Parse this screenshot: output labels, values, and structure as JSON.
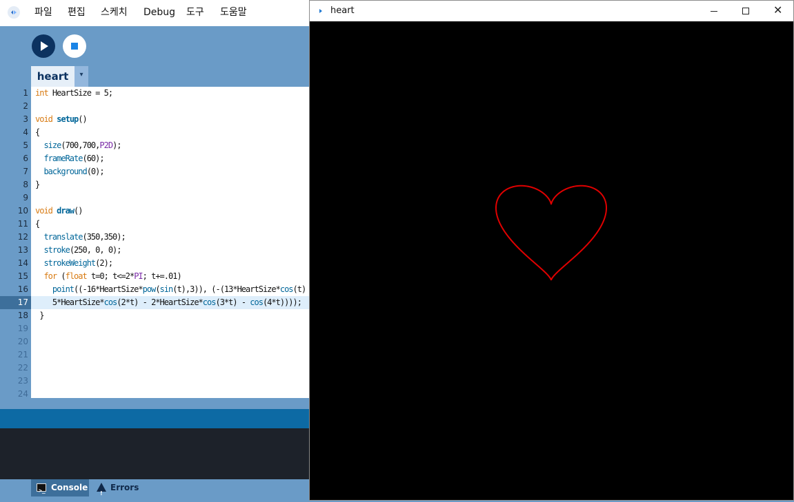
{
  "menu": [
    "파일",
    "편집",
    "스케치",
    "Debug",
    "도구",
    "도움말"
  ],
  "editor": {
    "tab_label": "heart",
    "tab_menu_glyph": "▾",
    "current_line": 17,
    "line_numbers": [
      "1",
      "2",
      "3",
      "4",
      "5",
      "6",
      "7",
      "8",
      "9",
      "10",
      "11",
      "12",
      "13",
      "14",
      "15",
      "16",
      "17",
      "18",
      "19",
      "20",
      "21",
      "22",
      "23",
      "24"
    ],
    "code": [
      [
        [
          "kw",
          "int"
        ],
        [
          "tx",
          " HeartSize = 5;"
        ]
      ],
      [],
      [
        [
          "kw",
          "void"
        ],
        [
          "tx",
          " "
        ],
        [
          "fn",
          "setup"
        ],
        [
          "tx",
          "()"
        ]
      ],
      [
        [
          "tx",
          "{"
        ]
      ],
      [
        [
          "tx",
          "  "
        ],
        [
          "fn2",
          "size"
        ],
        [
          "tx",
          "(700,700,"
        ],
        [
          "const",
          "P2D"
        ],
        [
          "tx",
          ");"
        ]
      ],
      [
        [
          "tx",
          "  "
        ],
        [
          "fn2",
          "frameRate"
        ],
        [
          "tx",
          "(60);"
        ]
      ],
      [
        [
          "tx",
          "  "
        ],
        [
          "fn2",
          "background"
        ],
        [
          "tx",
          "(0);"
        ]
      ],
      [
        [
          "tx",
          "}"
        ]
      ],
      [],
      [
        [
          "kw",
          "void"
        ],
        [
          "tx",
          " "
        ],
        [
          "fn",
          "draw"
        ],
        [
          "tx",
          "()"
        ]
      ],
      [
        [
          "tx",
          "{"
        ]
      ],
      [
        [
          "tx",
          "  "
        ],
        [
          "fn2",
          "translate"
        ],
        [
          "tx",
          "(350,350);"
        ]
      ],
      [
        [
          "tx",
          "  "
        ],
        [
          "fn2",
          "stroke"
        ],
        [
          "tx",
          "(250, 0, 0);"
        ]
      ],
      [
        [
          "tx",
          "  "
        ],
        [
          "fn2",
          "strokeWeight"
        ],
        [
          "tx",
          "(2);"
        ]
      ],
      [
        [
          "tx",
          "  "
        ],
        [
          "kw2",
          "for"
        ],
        [
          "tx",
          " ("
        ],
        [
          "kw2",
          "float"
        ],
        [
          "tx",
          " t=0; t<=2*"
        ],
        [
          "const",
          "PI"
        ],
        [
          "tx",
          "; t+=.01)"
        ]
      ],
      [
        [
          "tx",
          "    "
        ],
        [
          "fn2",
          "point"
        ],
        [
          "tx",
          "((-16*HeartSize*"
        ],
        [
          "fn2",
          "pow"
        ],
        [
          "tx",
          "("
        ],
        [
          "fn2",
          "sin"
        ],
        [
          "tx",
          "(t),3)), (-(13*HeartSize*"
        ],
        [
          "fn2",
          "cos"
        ],
        [
          "tx",
          "(t) - "
        ]
      ],
      [
        [
          "tx",
          "    5*HeartSize*"
        ],
        [
          "fn2",
          "cos"
        ],
        [
          "tx",
          "(2*t) - 2*HeartSize*"
        ],
        [
          "fn2",
          "cos"
        ],
        [
          "tx",
          "(3*t) - "
        ],
        [
          "fn2",
          "cos"
        ],
        [
          "tx",
          "(4*t))));"
        ]
      ],
      [
        [
          "tx",
          " }"
        ]
      ]
    ]
  },
  "bottom_tabs": {
    "console_label": "Console",
    "errors_label": "Errors",
    "console_icon": "terminal-icon",
    "errors_icon": "warning-icon"
  },
  "sketch_window": {
    "title": "heart",
    "background": "#000000",
    "stroke_color": "#e00000",
    "heart_size": 5
  },
  "colors": {
    "ide_blue": "#6a9bc7",
    "keyword": "#d87a11",
    "function": "#006699",
    "const": "#7a2aa7"
  }
}
